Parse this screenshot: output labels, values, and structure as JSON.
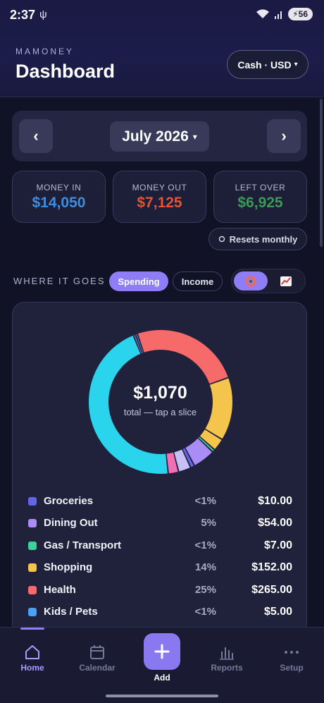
{
  "status_bar": {
    "time": "2:37",
    "usb_icon": "usb-icon",
    "battery": "56"
  },
  "header": {
    "app_name": "MAMONEY",
    "title": "Dashboard",
    "account_selector": "Cash · USD",
    "account_caret": "▾"
  },
  "month_nav": {
    "prev": "‹",
    "next": "›",
    "month": "July 2026",
    "caret": "▾"
  },
  "summary": [
    {
      "label": "MONEY IN",
      "value": "$14,050",
      "color": "#3f8ede"
    },
    {
      "label": "MONEY OUT",
      "value": "$7,125",
      "color": "#e0553a"
    },
    {
      "label": "LEFT OVER",
      "value": "$6,925",
      "color": "#3a9a58"
    }
  ],
  "resets_label": "Resets monthly",
  "where_it_goes": {
    "title": "WHERE IT GOES",
    "tabs": [
      "Spending",
      "Income"
    ],
    "active_tab": "Spending",
    "view_icons": [
      "donut-chart-icon",
      "line-chart-icon"
    ],
    "active_view": "donut-chart-icon"
  },
  "chart_data": {
    "type": "pie",
    "variant": "donut",
    "center_value": "$1,070",
    "center_caption": "total — tap a slice",
    "slices": [
      {
        "name": "Groceries",
        "pct_label": "<1%",
        "value": 10,
        "amount": "$10.00",
        "color": "#6465e6"
      },
      {
        "name": "Dining Out",
        "pct_label": "5%",
        "value": 54,
        "amount": "$54.00",
        "color": "#a98cf5"
      },
      {
        "name": "Gas / Transport",
        "pct_label": "<1%",
        "value": 7,
        "amount": "$7.00",
        "color": "#3ed09a"
      },
      {
        "name": "Shopping",
        "pct_label": "14%",
        "value": 152,
        "amount": "$152.00",
        "color": "#f4c44c"
      },
      {
        "name": "Health",
        "pct_label": "25%",
        "value": 265,
        "amount": "$265.00",
        "color": "#f66a6a"
      },
      {
        "name": "Kids / Pets",
        "pct_label": "<1%",
        "value": 5,
        "amount": "$5.00",
        "color": "#4aa0f2"
      }
    ],
    "unlisted_slices": [
      {
        "value": 30,
        "color": "#f4c44c"
      },
      {
        "value": 30,
        "color": "#c7bef5"
      },
      {
        "value": 25,
        "color": "#f06fb6"
      },
      {
        "value": 5,
        "color": "#a98cf5"
      },
      {
        "value": 487,
        "color": "#29d4ec"
      }
    ]
  },
  "bottom_nav": {
    "items": [
      {
        "label": "Home",
        "icon": "home-icon",
        "active": true
      },
      {
        "label": "Calendar",
        "icon": "calendar-icon",
        "active": false
      },
      {
        "label": "Add",
        "icon": "plus-icon",
        "active": false
      },
      {
        "label": "Reports",
        "icon": "bar-chart-icon",
        "active": false
      },
      {
        "label": "Setup",
        "icon": "more-icon",
        "active": false
      }
    ]
  }
}
